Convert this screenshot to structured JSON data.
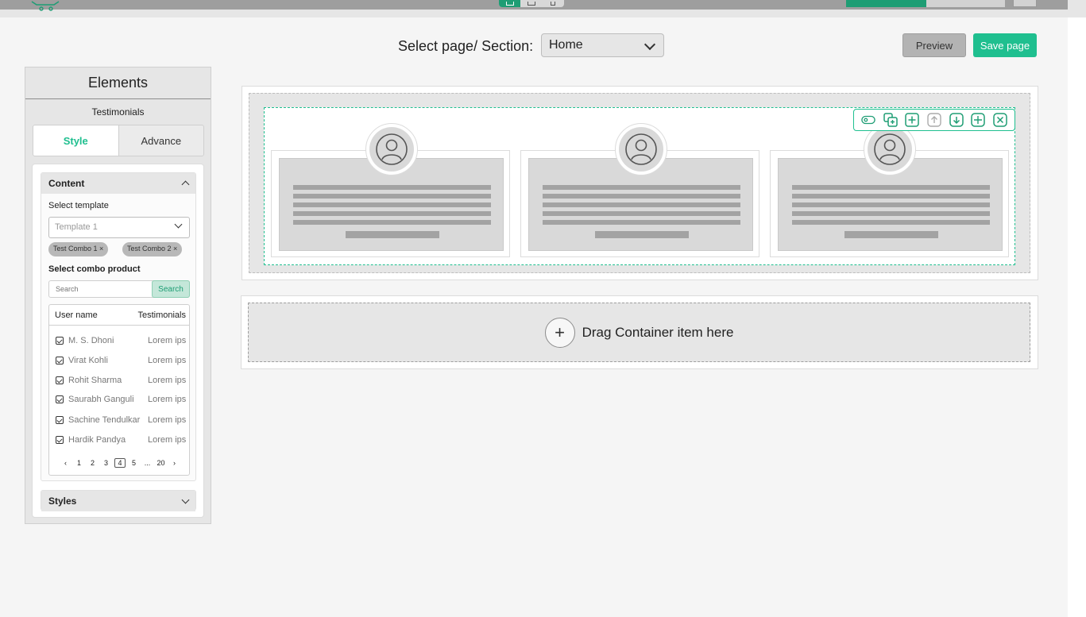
{
  "header": {
    "select_label": "Select page/ Section:",
    "page_value": "Home",
    "preview_label": "Preview",
    "save_label": "Save page"
  },
  "panel": {
    "title": "Elements",
    "subtitle": "Testimonials",
    "tabs": [
      {
        "label": "Style",
        "active": true
      },
      {
        "label": "Advance",
        "active": false
      }
    ],
    "content_section": {
      "title": "Content",
      "select_template_label": "Select template",
      "template_placeholder": "Template 1",
      "chips": [
        "Test Combo 1 ×",
        "Test Combo 2 ×"
      ],
      "combo_label": "Select combo product",
      "search_placeholder": "Search",
      "search_button": "Search",
      "table": {
        "columns": [
          "User name",
          "Testimonials"
        ],
        "rows": [
          {
            "name": "M. S. Dhoni",
            "text": "Lorem ips"
          },
          {
            "name": "Virat Kohli",
            "text": "Lorem ips"
          },
          {
            "name": "Rohit Sharma",
            "text": "Lorem ips"
          },
          {
            "name": "Saurabh Ganguli",
            "text": "Lorem ips"
          },
          {
            "name": "Sachine Tendulkar",
            "text": "Lorem ips"
          },
          {
            "name": "Hardik Pandya",
            "text": "Lorem ips"
          }
        ]
      },
      "pagination": {
        "prev": "‹",
        "pages": [
          "1",
          "2",
          "3",
          "4",
          "5",
          "...",
          "20"
        ],
        "current": "4",
        "next": "›"
      }
    },
    "styles_section": {
      "title": "Styles"
    }
  },
  "canvas": {
    "drop_label": "Drag Container item here",
    "drop_plus": "+"
  },
  "colors": {
    "accent": "#1fbf8f",
    "accent_dark": "#1e9d74",
    "panel_bg": "#e6e6e6",
    "placeholder_grey": "#d9d9d9"
  },
  "icons": [
    "cart-icon",
    "desktop-icon",
    "tablet-icon",
    "mobile-icon",
    "visibility-icon",
    "duplicate-icon",
    "add-icon",
    "move-up-icon",
    "move-down-icon",
    "move-icon",
    "close-icon",
    "user-avatar-icon",
    "chevron-down-icon",
    "chevron-up-icon",
    "plus-icon"
  ]
}
